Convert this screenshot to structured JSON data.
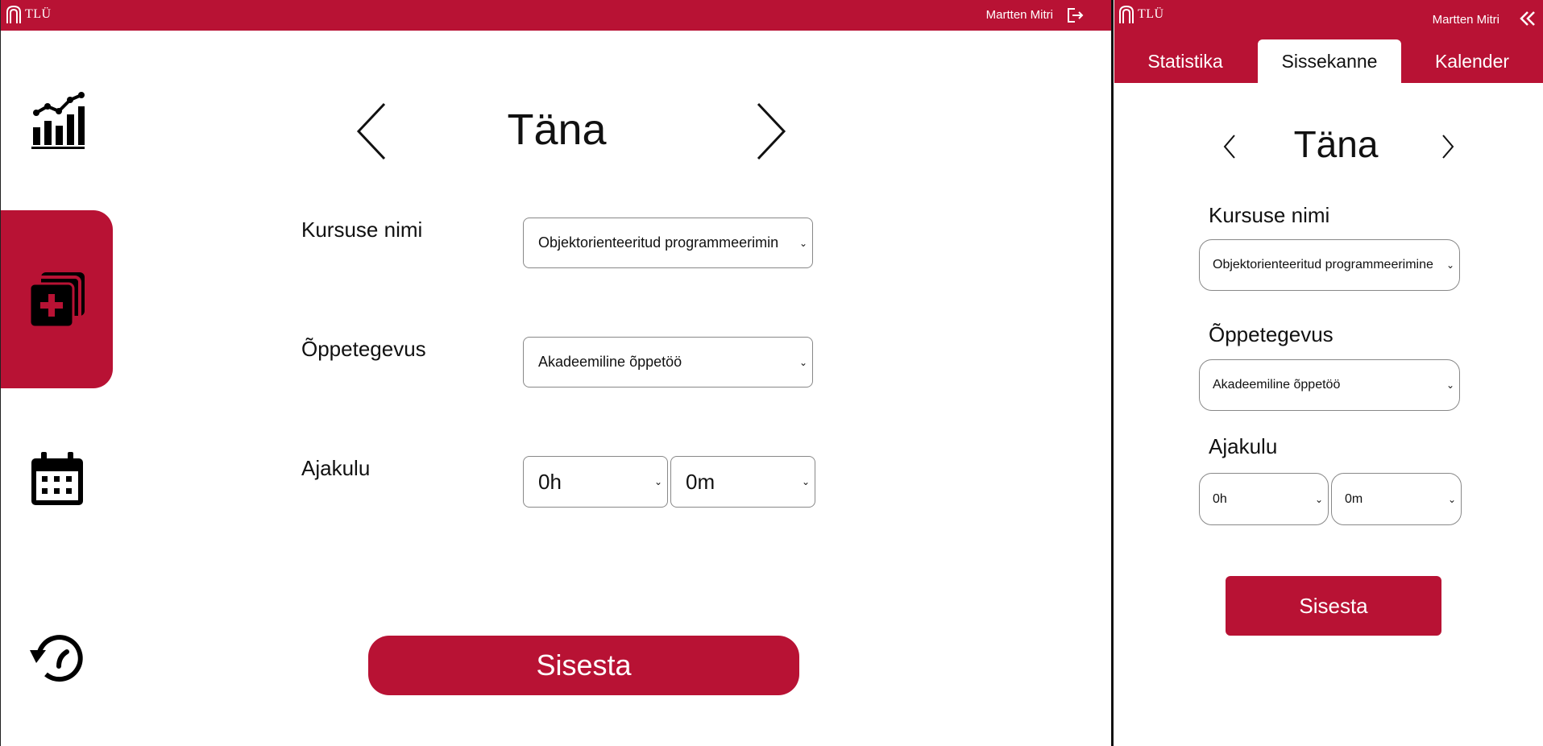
{
  "brand": {
    "logo_text": "TLÜ",
    "accent": "#b81234"
  },
  "user": {
    "name": "Martten Mitri"
  },
  "icons": {
    "logout": "logout-icon",
    "stats": "chart-icon",
    "entry": "add-entry-icon",
    "calendar": "calendar-icon",
    "history": "history-icon",
    "collapse": "double-chevron-left-icon"
  },
  "main": {
    "day_title": "Täna",
    "fields": {
      "course_label": "Kursuse nimi",
      "course_value": "Objektorienteeritud programmeerimin",
      "activity_label": "Õppetegevus",
      "activity_value": "Akadeemiline õppetöö",
      "time_label": "Ajakulu",
      "hours_value": "0h",
      "minutes_value": "0m"
    },
    "submit_label": "Sisesta"
  },
  "mobile": {
    "tabs": [
      {
        "label": "Statistika",
        "active": false
      },
      {
        "label": "Sissekanne",
        "active": true
      },
      {
        "label": "Kalender",
        "active": false
      }
    ],
    "day_title": "Täna",
    "fields": {
      "course_label": "Kursuse nimi",
      "course_value": "Objektorienteeritud programmeerimine",
      "activity_label": "Õppetegevus",
      "activity_value": "Akadeemiline õppetöö",
      "time_label": "Ajakulu",
      "hours_value": "0h",
      "minutes_value": "0m"
    },
    "submit_label": "Sisesta"
  }
}
